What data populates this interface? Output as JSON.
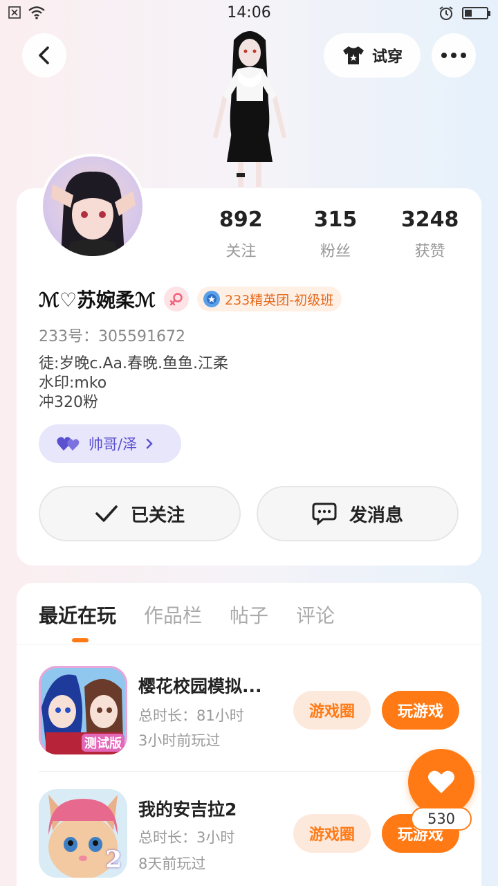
{
  "status_bar": {
    "time": "14:06"
  },
  "header": {
    "try_on_label": "试穿"
  },
  "profile": {
    "stats": [
      {
        "value": "892",
        "label": "关注"
      },
      {
        "value": "315",
        "label": "粉丝"
      },
      {
        "value": "3248",
        "label": "获赞"
      }
    ],
    "name": "ℳ♡苏婉柔ℳ",
    "badge_label": "233精英团-初级班",
    "uid": "233号：305591672",
    "bio": [
      "徒:岁晚c.Aa.春晚.鱼鱼.江柔",
      "水印:mko",
      "冲320粉"
    ],
    "relation_label": "帅哥/泽",
    "follow_button": "已关注",
    "message_button": "发消息"
  },
  "tabs": [
    "最近在玩",
    "作品栏",
    "帖子",
    "评论"
  ],
  "games": [
    {
      "title": "樱花校园模拟...",
      "duration": "总时长：81小时",
      "last_played": "3小时前玩过",
      "icon_badge": "测试版",
      "circle_label": "游戏圈",
      "play_label": "玩游戏"
    },
    {
      "title": "我的安吉拉2",
      "duration": "总时长：3小时",
      "last_played": "8天前玩过",
      "icon_badge": "2",
      "circle_label": "游戏圈",
      "play_label": "玩游戏"
    }
  ],
  "like": {
    "count": "530"
  },
  "colors": {
    "accent": "#ff7a14",
    "relation": "#5a50d0"
  }
}
